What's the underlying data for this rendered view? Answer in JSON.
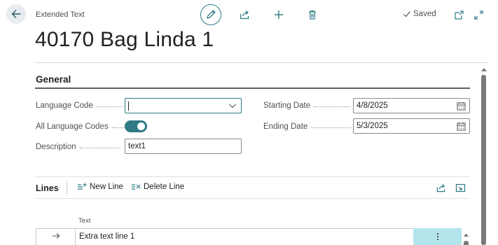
{
  "header": {
    "page_type": "Extended Text",
    "title": "40170 Bag Linda 1",
    "saved_label": "Saved",
    "icons": [
      "back-arrow-icon",
      "pencil-icon",
      "share-icon",
      "plus-icon",
      "trash-icon",
      "checkmark-icon",
      "open-new-window-icon",
      "expand-icon"
    ]
  },
  "general": {
    "title": "General",
    "language_code": {
      "label": "Language Code",
      "value": ""
    },
    "all_language_codes": {
      "label": "All Language Codes",
      "on": true
    },
    "description": {
      "label": "Description",
      "value": "text1"
    },
    "starting_date": {
      "label": "Starting Date",
      "value": "4/8/2025"
    },
    "ending_date": {
      "label": "Ending Date",
      "value": "5/3/2025"
    }
  },
  "lines": {
    "title": "Lines",
    "new_line_label": "New Line",
    "delete_line_label": "Delete Line",
    "column_text": "Text",
    "rows": [
      {
        "text": "Extra text line 1"
      }
    ]
  },
  "colors": {
    "accent": "#2d7a84",
    "row_highlight": "#b5e5ec"
  }
}
